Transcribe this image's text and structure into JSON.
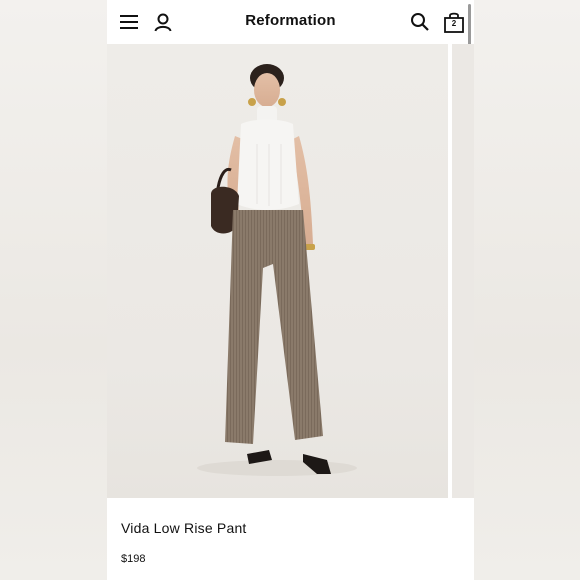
{
  "header": {
    "brand": "Reformation",
    "bag_count": "2",
    "icons": [
      "menu-icon",
      "account-icon",
      "search-icon",
      "bag-icon"
    ]
  },
  "product": {
    "name": "Vida Low Rise Pant",
    "price": "$198",
    "image_alt": "Model wearing sleeveless white turtleneck and brown pinstripe low rise wide-leg pants"
  },
  "colors": {
    "background": "#f0eeeb",
    "image_bg": "#ebe8e4",
    "text": "#111111"
  }
}
